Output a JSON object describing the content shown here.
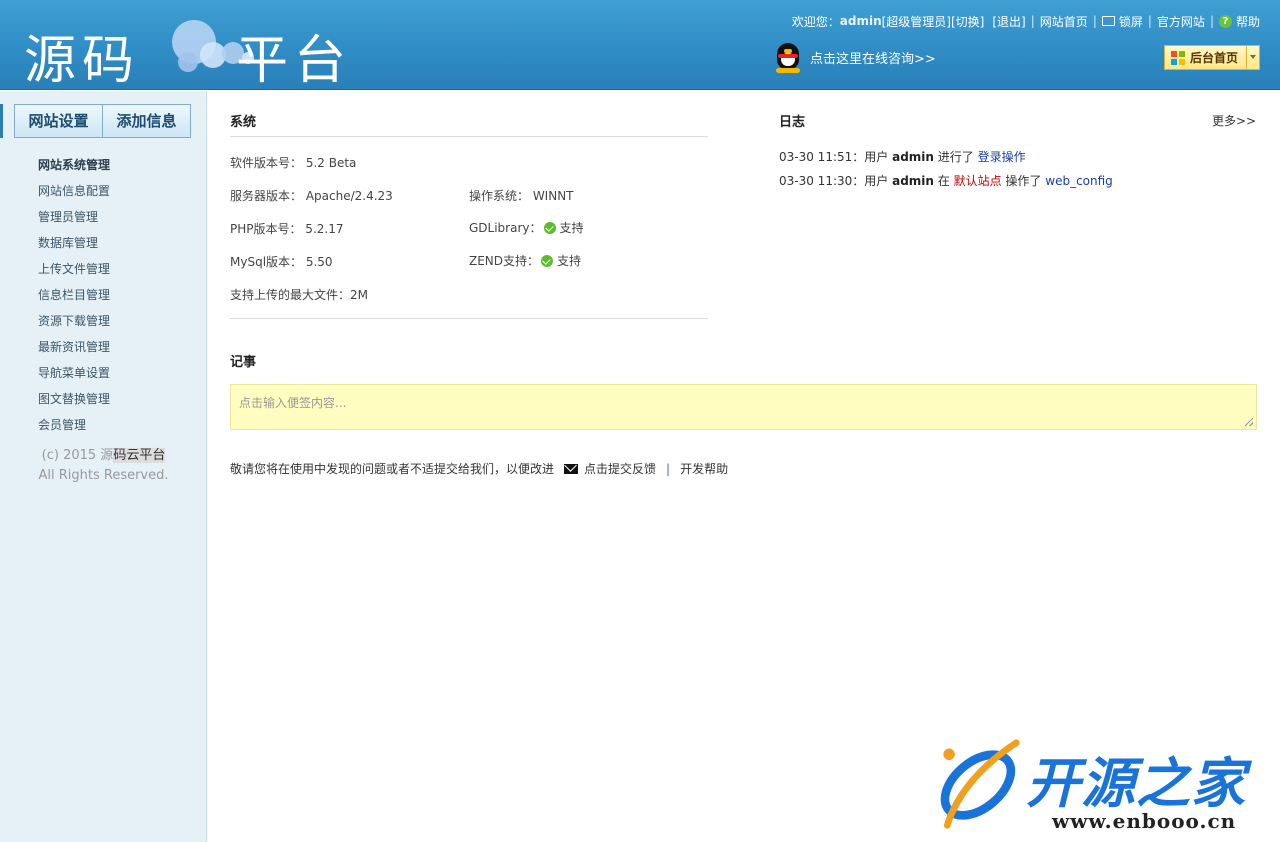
{
  "header": {
    "logo": {
      "part1": "源码",
      "part2": "平台"
    },
    "toplinks": {
      "welcome": "欢迎您：",
      "username": "admin",
      "role": "[超级管理员]",
      "switch": "[切换]",
      "logout": "[退出]",
      "site_home": "网站首页",
      "lock": "锁屏",
      "official": "官方网站",
      "help": "帮助",
      "separator": "|"
    },
    "consult": "点击这里在线咨询>>",
    "home_button": "后台首页"
  },
  "sidebar": {
    "tabs": [
      "网站设置",
      "添加信息"
    ],
    "menu_head": "网站系统管理",
    "menu": [
      "网站信息配置",
      "管理员管理",
      "数据库管理",
      "上传文件管理",
      "信息栏目管理",
      "资源下载管理",
      "最新资讯管理",
      "导航菜单设置",
      "图文替换管理",
      "会员管理"
    ],
    "copyright": {
      "prefix": "(c) 2015 源",
      "highlight": "码云平台",
      "line2": "All Rights Reserved."
    }
  },
  "system": {
    "title": "系统",
    "software_version": "软件版本号： 5.2 Beta",
    "server_version": "服务器版本： Apache/2.4.23",
    "os": "操作系统： WINNT",
    "php_version": "PHP版本号： 5.2.17",
    "gdlibrary_label": "GDLibrary：",
    "gdlibrary_value": "支持",
    "mysql_version": "MySql版本： 5.50",
    "zend_label": "ZEND支持：",
    "zend_value": "支持",
    "max_upload": "支持上传的最大文件：2M"
  },
  "log": {
    "title": "日志",
    "more": "更多>>",
    "entries": [
      {
        "time": "03-30 11:51：用户 ",
        "user": "admin",
        "mid": " 进行了 ",
        "link": "登录操作"
      },
      {
        "time": "03-30 11:30：用户 ",
        "user": "admin",
        "mid": " 在 ",
        "red": "默认站点",
        "mid2": " 操作了 ",
        "link": "web_config"
      }
    ]
  },
  "notes": {
    "title": "记事",
    "placeholder": "点击输入便签内容..."
  },
  "feedback": {
    "text": "敬请您将在使用中发现的问题或者不适提交给我们，以便改进",
    "submit": "点击提交反馈",
    "sep": "|",
    "dev_help": "开发帮助"
  },
  "watermark": {
    "brand": "开源之家",
    "url": "www.enbooo.cn"
  }
}
